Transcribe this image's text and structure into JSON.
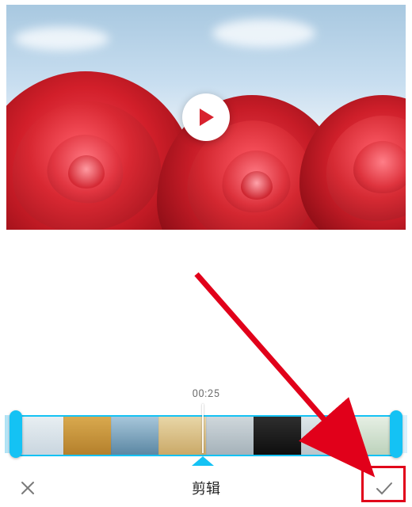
{
  "colors": {
    "accent": "#14c2f4",
    "annotation": "#e1001a"
  },
  "preview": {
    "play_icon": "play-icon"
  },
  "trim": {
    "timestamp": "00:25",
    "thumbs": [
      {
        "bg": "linear-gradient(#e8eef2,#c9d6df)"
      },
      {
        "bg": "linear-gradient(#d9a94e,#b4802c)"
      },
      {
        "bg": "linear-gradient(#a7c6da,#5b87a3)"
      },
      {
        "bg": "linear-gradient(#e8d6a7,#caa968)"
      },
      {
        "bg": "linear-gradient(#cfd7db,#a5b2ba)"
      },
      {
        "bg": "linear-gradient(#2e2e2e,#0e0e0e)"
      },
      {
        "bg": "linear-gradient(#dfe7ea,#b9c5cb)"
      },
      {
        "bg": "linear-gradient(#e6efe4,#bcd2bb)"
      }
    ]
  },
  "bottom": {
    "cancel_icon": "close-icon",
    "title": "剪辑",
    "confirm_icon": "check-icon"
  }
}
